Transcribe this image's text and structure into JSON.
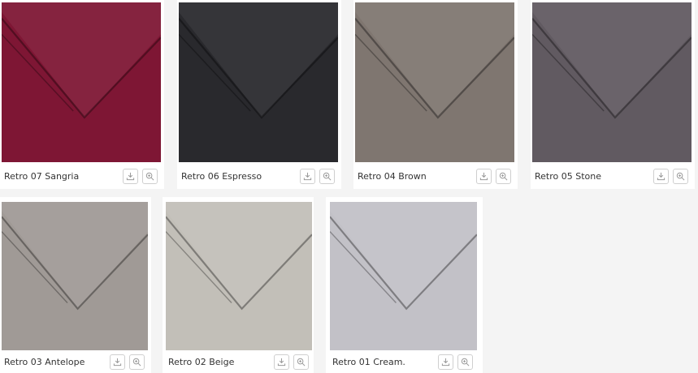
{
  "swatches": [
    {
      "name": "Retro 07 Sangria",
      "color": "#7e1634"
    },
    {
      "name": "Retro 06 Espresso",
      "color": "#29292d"
    },
    {
      "name": "Retro 04 Brown",
      "color": "#7f7670"
    },
    {
      "name": "Retro 05 Stone",
      "color": "#615a61"
    },
    {
      "name": "Retro 03 Antelope",
      "color": "#a09a96"
    },
    {
      "name": "Retro 02 Beige",
      "color": "#c2bfb8"
    },
    {
      "name": "Retro 01 Cream.",
      "color": "#c2c1c7"
    }
  ],
  "icons": {
    "download": "download-icon",
    "zoom": "zoom-in-icon"
  }
}
